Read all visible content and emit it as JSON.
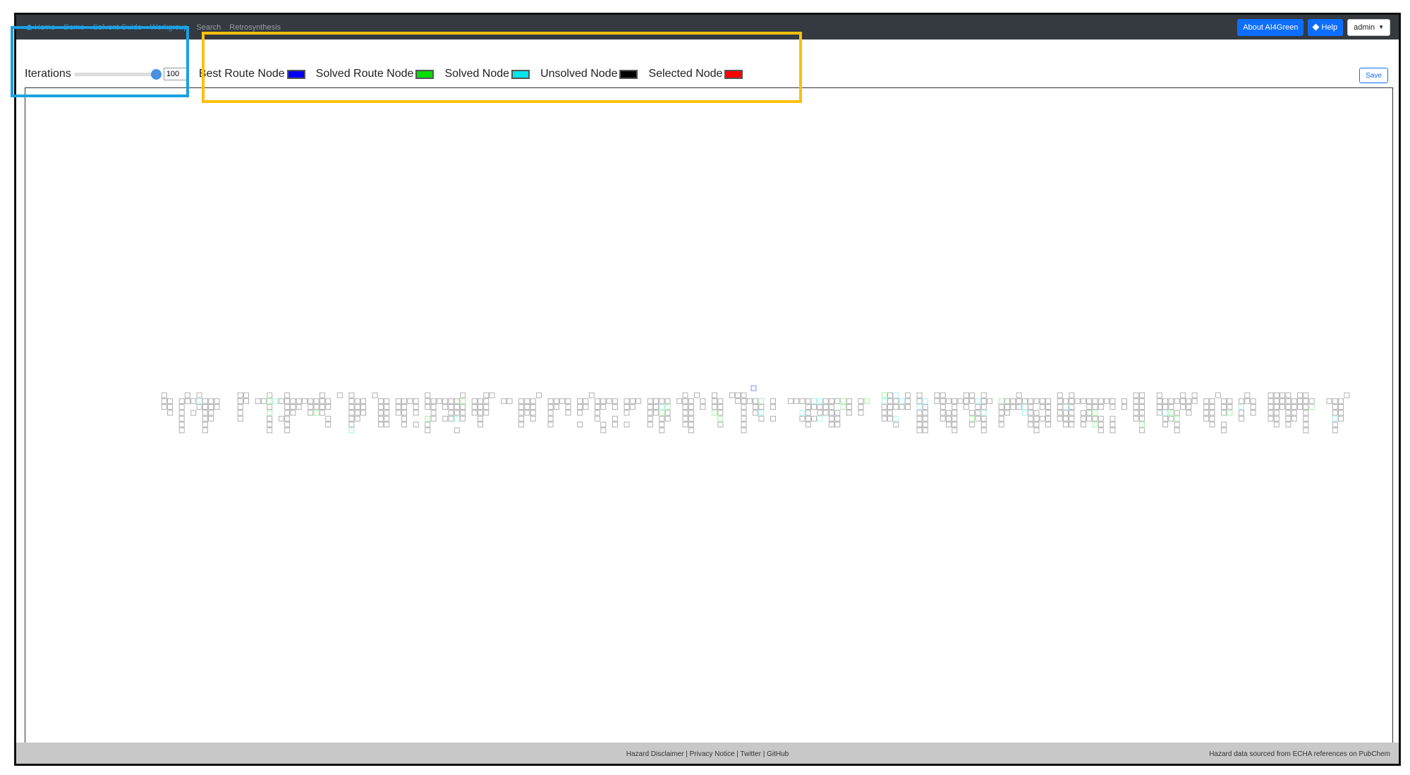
{
  "nav": {
    "home": "Home",
    "items": [
      "Demo",
      "Solvent Guide",
      "Workgroup",
      "Search",
      "Retrosynthesis"
    ],
    "about": "About AI4Green",
    "help": "Help",
    "user": "admin"
  },
  "controls": {
    "iterations_label": "Iterations",
    "iterations_value": "100",
    "iterations_slider_level": 1.0
  },
  "legend": [
    {
      "label": "Best Route Node",
      "color": "#0000ff"
    },
    {
      "label": "Solved Route Node",
      "color": "#00dd00"
    },
    {
      "label": "Solved Node",
      "color": "#00e5ee"
    },
    {
      "label": "Unsolved Node",
      "color": "#000000"
    },
    {
      "label": "Selected Node",
      "color": "#ff0000"
    }
  ],
  "save_label": "Save",
  "footer": {
    "links": [
      "Hazard Disclaimer",
      "Privacy Notice",
      "Twitter",
      "GitHub"
    ],
    "source": "Hazard data sourced from ECHA references on PubChem"
  }
}
